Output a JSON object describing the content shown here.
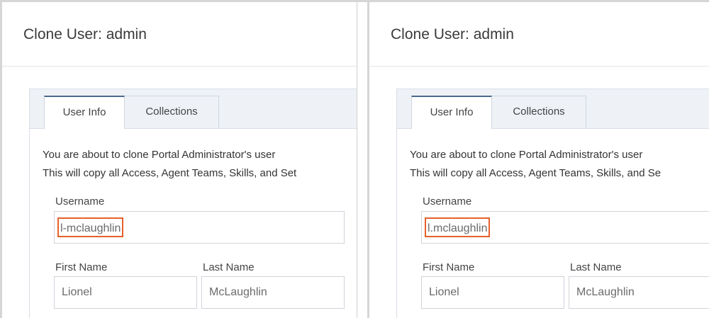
{
  "panels": [
    {
      "title": "Clone User: admin",
      "tabs": [
        "User Info",
        "Collections"
      ],
      "description_line1": "You are about to clone Portal Administrator's user",
      "description_line2": "This will copy all Access, Agent Teams, Skills, and Set",
      "username_label": "Username",
      "username_value": "l-mclaughlin",
      "first_name_label": "First Name",
      "first_name_value": "Lionel",
      "last_name_label": "Last Name",
      "last_name_value": "McLaughlin"
    },
    {
      "title": "Clone User: admin",
      "tabs": [
        "User Info",
        "Collections"
      ],
      "description_line1": "You are about to clone Portal Administrator's user",
      "description_line2": "This will copy all Access, Agent Teams, Skills, and Se",
      "username_label": "Username",
      "username_value": "l.mclaughlin",
      "first_name_label": "First Name",
      "first_name_value": "Lionel",
      "last_name_label": "Last Name",
      "last_name_value": "McLaughlin"
    }
  ],
  "colors": {
    "highlight": "#e5602b",
    "active_tab_border": "#4a6a8a",
    "tabbar_bg": "#eef2f7"
  }
}
